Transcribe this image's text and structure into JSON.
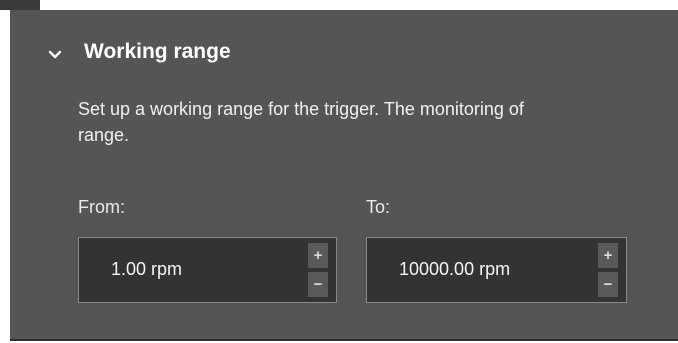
{
  "section": {
    "title": "Working range",
    "description_lines": [
      "Set up a working range for the trigger. The monitoring of",
      "range."
    ]
  },
  "fields": {
    "from": {
      "label": "From:",
      "value": "1.00 rpm"
    },
    "to": {
      "label": "To:",
      "value": "10000.00 rpm"
    }
  },
  "spinner_buttons": {
    "increment": "+",
    "decrement": "−"
  },
  "icons": {
    "collapse": "chevron-down-icon"
  },
  "colors": {
    "panel_bg": "#555555",
    "input_bg": "#333333",
    "input_border": "#8a8a8a",
    "text": "#ffffff"
  }
}
